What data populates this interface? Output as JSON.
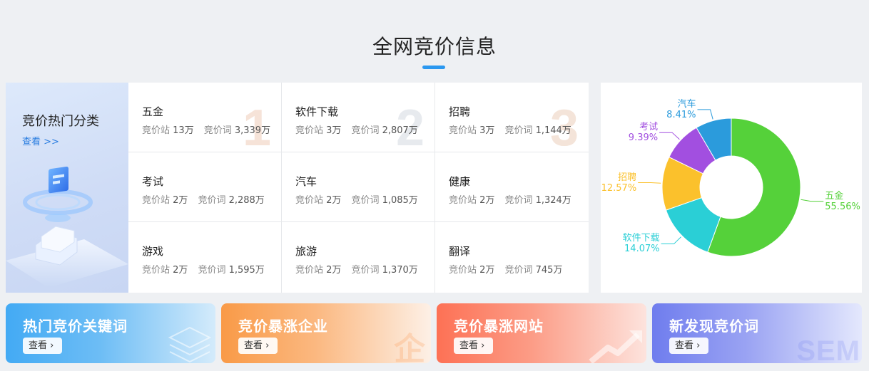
{
  "header": {
    "title": "全网竞价信息"
  },
  "hero": {
    "title": "竞价热门分类",
    "link": "查看 >>"
  },
  "stat_labels": {
    "sites": "竞价站",
    "words": "竞价词"
  },
  "categories": [
    {
      "name": "五金",
      "sites": "13万",
      "words": "3,339万",
      "rank": "1"
    },
    {
      "name": "软件下载",
      "sites": "3万",
      "words": "2,807万",
      "rank": "2"
    },
    {
      "name": "招聘",
      "sites": "3万",
      "words": "1,144万",
      "rank": "3"
    },
    {
      "name": "考试",
      "sites": "2万",
      "words": "2,288万"
    },
    {
      "name": "汽车",
      "sites": "2万",
      "words": "1,085万"
    },
    {
      "name": "健康",
      "sites": "2万",
      "words": "1,324万"
    },
    {
      "name": "游戏",
      "sites": "2万",
      "words": "1,595万"
    },
    {
      "name": "旅游",
      "sites": "2万",
      "words": "1,370万"
    },
    {
      "name": "翻译",
      "sites": "2万",
      "words": "745万"
    }
  ],
  "chart_data": {
    "type": "pie",
    "variant": "donut",
    "slices": [
      {
        "name": "五金",
        "label": "55.56%",
        "value": 55.56,
        "color": "#55d13a"
      },
      {
        "name": "软件下载",
        "label": "14.07%",
        "value": 14.07,
        "color": "#2acfd6"
      },
      {
        "name": "招聘",
        "label": "12.57%",
        "value": 12.57,
        "color": "#fbc12c"
      },
      {
        "name": "考试",
        "label": "9.39%",
        "value": 9.39,
        "color": "#a24fe0"
      },
      {
        "name": "汽车",
        "label": "8.41%",
        "value": 8.41,
        "color": "#2b9bdc"
      }
    ]
  },
  "cards": [
    {
      "title": "热门竞价关键词",
      "button": "查看",
      "color": "#43aaf4"
    },
    {
      "title": "竞价暴涨企业",
      "button": "查看",
      "color": "#f99a47",
      "deco": "企"
    },
    {
      "title": "竞价暴涨网站",
      "button": "查看",
      "color": "#fd7155"
    },
    {
      "title": "新发现竞价词",
      "button": "查看",
      "color": "#6f7dee",
      "deco": "SEM"
    }
  ]
}
